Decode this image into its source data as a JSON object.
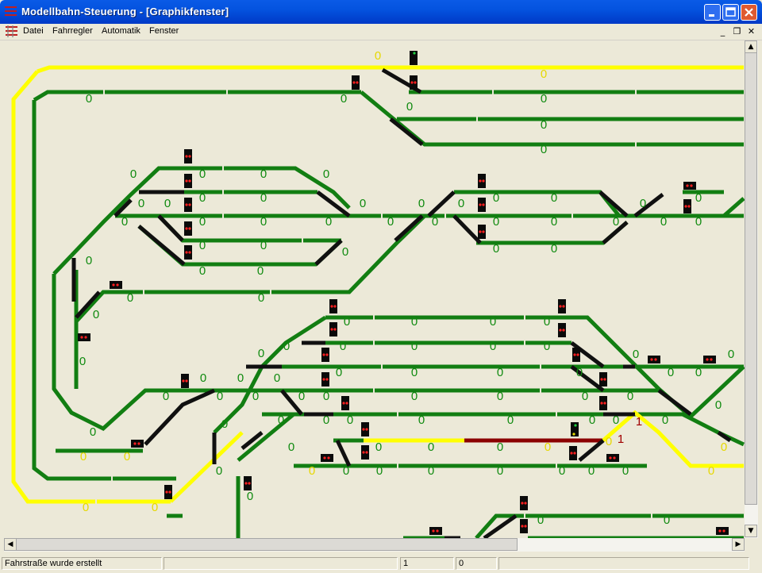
{
  "window": {
    "title": "Modellbahn-Steuerung - [Graphikfenster]"
  },
  "menu": {
    "items": [
      "Datei",
      "Fahrregler",
      "Automatik",
      "Fenster"
    ]
  },
  "mdi": {
    "minimize": "_",
    "restore": "❐",
    "close": "✕"
  },
  "colors": {
    "green": "#127e12",
    "yellow": "#ffff00",
    "black": "#101010",
    "red": "#8b0000",
    "signal_red": "#ff2020",
    "signal_green": "#20d040",
    "label_green": "#0f8a0f",
    "label_yellow": "#e6d800",
    "label_red": "#a00000"
  },
  "status": {
    "message": "Fahrstraße wurde erstellt",
    "field2": "",
    "field3": "1",
    "field4": "0",
    "field5": ""
  },
  "scroll": {
    "up": "▲",
    "down": "▼",
    "left": "◀",
    "right": "▶"
  },
  "labels": [
    {
      "id": 0,
      "text": "0",
      "c": "y"
    },
    {
      "id": 1,
      "text": "0",
      "c": "y"
    },
    {
      "id": 2,
      "text": "0",
      "c": "g"
    },
    {
      "id": 3,
      "text": "0",
      "c": "g"
    },
    {
      "id": 4,
      "text": "0",
      "c": "g"
    },
    {
      "id": 5,
      "text": "0",
      "c": "g"
    },
    {
      "id": 6,
      "text": "0",
      "c": "g"
    },
    {
      "id": 7,
      "text": "0",
      "c": "g"
    },
    {
      "id": 8,
      "text": "0",
      "c": "g"
    },
    {
      "id": 9,
      "text": "0",
      "c": "g"
    },
    {
      "id": 10,
      "text": "0",
      "c": "g"
    },
    {
      "id": 11,
      "text": "0",
      "c": "g"
    },
    {
      "id": 12,
      "text": "0",
      "c": "g"
    },
    {
      "id": 13,
      "text": "0",
      "c": "g"
    },
    {
      "id": 14,
      "text": "0",
      "c": "g"
    },
    {
      "id": 15,
      "text": "0",
      "c": "g"
    },
    {
      "id": 16,
      "text": "0",
      "c": "g"
    },
    {
      "id": 17,
      "text": "0",
      "c": "g"
    },
    {
      "id": 18,
      "text": "0",
      "c": "g"
    },
    {
      "id": 19,
      "text": "0",
      "c": "g"
    },
    {
      "id": 20,
      "text": "0",
      "c": "g"
    },
    {
      "id": 21,
      "text": "0",
      "c": "g"
    },
    {
      "id": 22,
      "text": "0",
      "c": "g"
    },
    {
      "id": 23,
      "text": "0",
      "c": "g"
    },
    {
      "id": 24,
      "text": "0",
      "c": "g"
    },
    {
      "id": 25,
      "text": "0",
      "c": "g"
    },
    {
      "id": 26,
      "text": "0",
      "c": "g"
    },
    {
      "id": 27,
      "text": "0",
      "c": "g"
    },
    {
      "id": 28,
      "text": "0",
      "c": "g"
    },
    {
      "id": 29,
      "text": "0",
      "c": "g"
    },
    {
      "id": 30,
      "text": "0",
      "c": "g"
    },
    {
      "id": 31,
      "text": "0",
      "c": "g"
    },
    {
      "id": 32,
      "text": "0",
      "c": "g"
    },
    {
      "id": 33,
      "text": "0",
      "c": "g"
    },
    {
      "id": 34,
      "text": "0",
      "c": "g"
    },
    {
      "id": 35,
      "text": "0",
      "c": "g"
    },
    {
      "id": 36,
      "text": "0",
      "c": "g"
    },
    {
      "id": 37,
      "text": "0",
      "c": "g"
    },
    {
      "id": 38,
      "text": "0",
      "c": "g"
    },
    {
      "id": 39,
      "text": "0",
      "c": "g"
    },
    {
      "id": 40,
      "text": "0",
      "c": "g"
    },
    {
      "id": 41,
      "text": "0",
      "c": "g"
    },
    {
      "id": 42,
      "text": "0",
      "c": "g"
    },
    {
      "id": 43,
      "text": "0",
      "c": "g"
    },
    {
      "id": 44,
      "text": "0",
      "c": "g"
    },
    {
      "id": 45,
      "text": "0",
      "c": "g"
    },
    {
      "id": 46,
      "text": "0",
      "c": "g"
    },
    {
      "id": 47,
      "text": "0",
      "c": "g"
    },
    {
      "id": 48,
      "text": "0",
      "c": "g"
    },
    {
      "id": 49,
      "text": "0",
      "c": "g"
    },
    {
      "id": 50,
      "text": "0",
      "c": "g"
    },
    {
      "id": 51,
      "text": "0",
      "c": "g"
    },
    {
      "id": 52,
      "text": "0",
      "c": "g"
    },
    {
      "id": 53,
      "text": "0",
      "c": "g"
    },
    {
      "id": 54,
      "text": "0",
      "c": "g"
    },
    {
      "id": 55,
      "text": "0",
      "c": "g"
    },
    {
      "id": 56,
      "text": "0",
      "c": "g"
    },
    {
      "id": 57,
      "text": "0",
      "c": "g"
    },
    {
      "id": 58,
      "text": "0",
      "c": "g"
    },
    {
      "id": 59,
      "text": "0",
      "c": "g"
    },
    {
      "id": 60,
      "text": "0",
      "c": "g"
    },
    {
      "id": 61,
      "text": "0",
      "c": "g"
    },
    {
      "id": 62,
      "text": "0",
      "c": "g"
    },
    {
      "id": 63,
      "text": "0",
      "c": "g"
    },
    {
      "id": 64,
      "text": "0",
      "c": "g"
    },
    {
      "id": 65,
      "text": "0",
      "c": "g"
    },
    {
      "id": 66,
      "text": "0",
      "c": "g"
    },
    {
      "id": 67,
      "text": "0",
      "c": "g"
    },
    {
      "id": 68,
      "text": "0",
      "c": "g"
    },
    {
      "id": 69,
      "text": "0",
      "c": "g"
    },
    {
      "id": 70,
      "text": "0",
      "c": "g"
    },
    {
      "id": 71,
      "text": "0",
      "c": "g"
    },
    {
      "id": 72,
      "text": "0",
      "c": "g"
    },
    {
      "id": 73,
      "text": "0",
      "c": "g"
    },
    {
      "id": 74,
      "text": "0",
      "c": "g"
    },
    {
      "id": 75,
      "text": "0",
      "c": "g"
    },
    {
      "id": 76,
      "text": "0",
      "c": "g"
    },
    {
      "id": 77,
      "text": "0",
      "c": "g"
    },
    {
      "id": 78,
      "text": "0",
      "c": "g"
    },
    {
      "id": 79,
      "text": "0",
      "c": "g"
    },
    {
      "id": 80,
      "text": "0",
      "c": "g"
    },
    {
      "id": 81,
      "text": "0",
      "c": "g"
    },
    {
      "id": 82,
      "text": "0",
      "c": "g"
    },
    {
      "id": 83,
      "text": "0",
      "c": "g"
    },
    {
      "id": 84,
      "text": "0",
      "c": "g"
    },
    {
      "id": 85,
      "text": "0",
      "c": "g"
    },
    {
      "id": 86,
      "text": "0",
      "c": "g"
    },
    {
      "id": 87,
      "text": "0",
      "c": "g"
    },
    {
      "id": 88,
      "text": "0",
      "c": "g"
    },
    {
      "id": 89,
      "text": "0",
      "c": "g"
    },
    {
      "id": 90,
      "text": "0",
      "c": "g"
    },
    {
      "id": 91,
      "text": "0",
      "c": "y"
    },
    {
      "id": 92,
      "text": "0",
      "c": "y"
    },
    {
      "id": 93,
      "text": "1",
      "c": "r"
    },
    {
      "id": 94,
      "text": "1",
      "c": "r"
    },
    {
      "id": 95,
      "text": "0",
      "c": "y"
    },
    {
      "id": 96,
      "text": "0",
      "c": "y"
    },
    {
      "id": 97,
      "text": "0",
      "c": "y"
    },
    {
      "id": 98,
      "text": "0",
      "c": "y"
    },
    {
      "id": 99,
      "text": "0",
      "c": "y"
    },
    {
      "id": 100,
      "text": "0",
      "c": "y"
    },
    {
      "id": 101,
      "text": "0",
      "c": "y"
    },
    {
      "id": 102,
      "text": "0",
      "c": "g"
    },
    {
      "id": 103,
      "text": "0",
      "c": "g"
    },
    {
      "id": 104,
      "text": "0",
      "c": "g"
    },
    {
      "id": 105,
      "text": "0",
      "c": "g"
    },
    {
      "id": 106,
      "text": "0",
      "c": "g"
    },
    {
      "id": 107,
      "text": "0",
      "c": "g"
    },
    {
      "id": 108,
      "text": "0",
      "c": "g"
    },
    {
      "id": 109,
      "text": "0",
      "c": "g"
    },
    {
      "id": 110,
      "text": "0",
      "c": "g"
    },
    {
      "id": 111,
      "text": "0",
      "c": "g"
    },
    {
      "id": 112,
      "text": "0",
      "c": "g"
    },
    {
      "id": 113,
      "text": "0",
      "c": "g"
    },
    {
      "id": 114,
      "text": "0",
      "c": "g"
    },
    {
      "id": 115,
      "text": "0",
      "c": "g"
    },
    {
      "id": 116,
      "text": "0",
      "c": "g"
    },
    {
      "id": 117,
      "text": "0",
      "c": "g"
    }
  ]
}
